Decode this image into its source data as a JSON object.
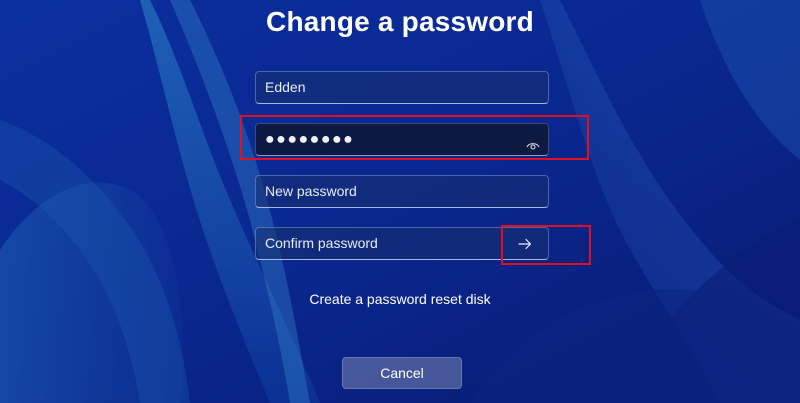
{
  "title": "Change a password",
  "fields": {
    "username": {
      "value": "Edden"
    },
    "current_password": {
      "masked_value": "●●●●●●●●",
      "reveal_icon": "eye-icon"
    },
    "new_password": {
      "placeholder": "New password"
    },
    "confirm_password": {
      "placeholder": "Confirm password",
      "submit_icon": "arrow-right-icon"
    }
  },
  "links": {
    "reset_disk": "Create a password reset disk"
  },
  "buttons": {
    "cancel": "Cancel"
  },
  "colors": {
    "highlight": "#e01020",
    "background": "#0a2a9a",
    "text": "#ffffff"
  }
}
